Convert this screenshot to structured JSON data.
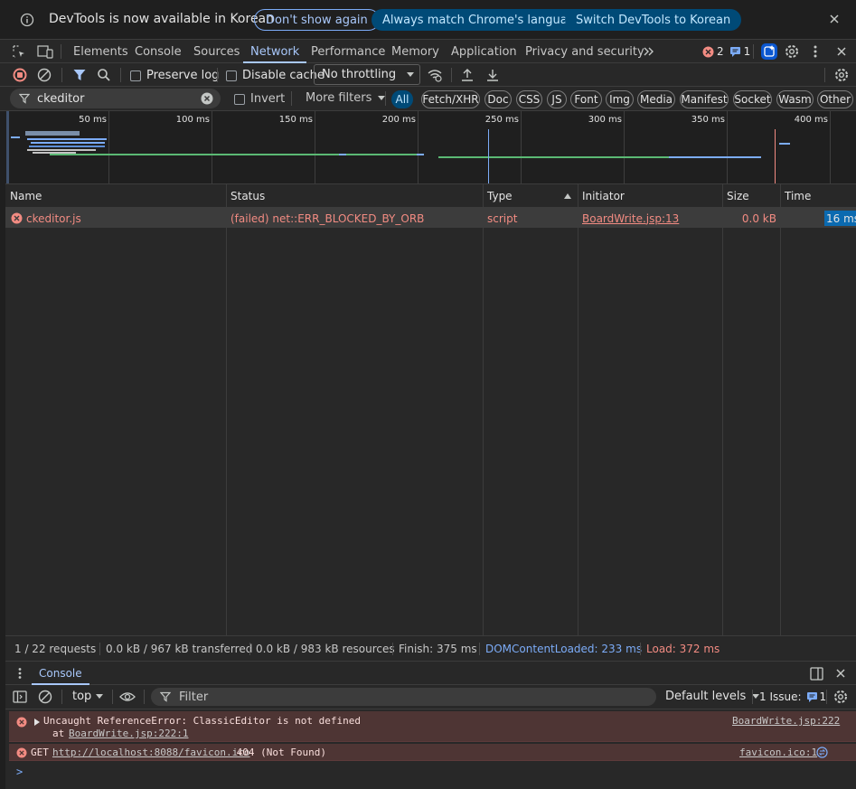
{
  "infobar": {
    "message": "DevTools is now available in Korean",
    "dont_show": "Don't show again",
    "always_match": "Always match Chrome's language",
    "switch_lang": "Switch DevTools to Korean"
  },
  "tabs": [
    "Elements",
    "Console",
    "Sources",
    "Network",
    "Performance",
    "Memory",
    "Application",
    "Privacy and security"
  ],
  "active_tab": "Network",
  "badges": {
    "errors": "2",
    "issues": "1"
  },
  "toolbar": {
    "preserve_log": "Preserve log",
    "disable_cache": "Disable cache",
    "throttling": "No throttling"
  },
  "filter": {
    "value": "ckeditor",
    "invert": "Invert",
    "more_filters": "More filters",
    "chips": [
      "All",
      "Fetch/XHR",
      "Doc",
      "CSS",
      "JS",
      "Font",
      "Img",
      "Media",
      "Manifest",
      "Socket",
      "Wasm",
      "Other"
    ]
  },
  "overview": {
    "ticks": [
      "50 ms",
      "100 ms",
      "150 ms",
      "200 ms",
      "250 ms",
      "300 ms",
      "350 ms",
      "400 ms"
    ]
  },
  "table": {
    "headers": {
      "name": "Name",
      "status": "Status",
      "type": "Type",
      "initiator": "Initiator",
      "size": "Size",
      "time": "Time"
    },
    "rows": [
      {
        "name": "ckeditor.js",
        "status": "(failed) net::ERR_BLOCKED_BY_ORB",
        "type": "script",
        "initiator": "BoardWrite.jsp:13",
        "size": "0.0 kB",
        "time": "16 ms"
      }
    ]
  },
  "summary": {
    "requests": "1 / 22 requests",
    "transferred": "0.0 kB / 967 kB transferred",
    "resources": "0.0 kB / 983 kB resources",
    "finish": "Finish: 375 ms",
    "dcl": "DOMContentLoaded: 233 ms",
    "load": "Load: 372 ms"
  },
  "drawer": {
    "tab": "Console",
    "context": "top",
    "filter_placeholder": "Filter",
    "levels": "Default levels",
    "issues_label": "1 Issue:",
    "issues_count": "1"
  },
  "console": {
    "messages": [
      {
        "text": "Uncaught ReferenceError: ClassicEditor is not defined",
        "sub_prefix": "at ",
        "sub_link": "BoardWrite.jsp:222:1",
        "source": "BoardWrite.jsp:222"
      },
      {
        "prefix": "GET ",
        "url": "http://localhost:8088/favicon.ico",
        "suffix": " 404 (Not Found)",
        "source": "favicon.ico:1"
      }
    ],
    "prompt": ">"
  },
  "colors": {
    "accent": "#a8c7fa",
    "error": "#f28b82",
    "dcl": "#7cacf8",
    "load": "#f28b82",
    "link": "#f28b82"
  }
}
